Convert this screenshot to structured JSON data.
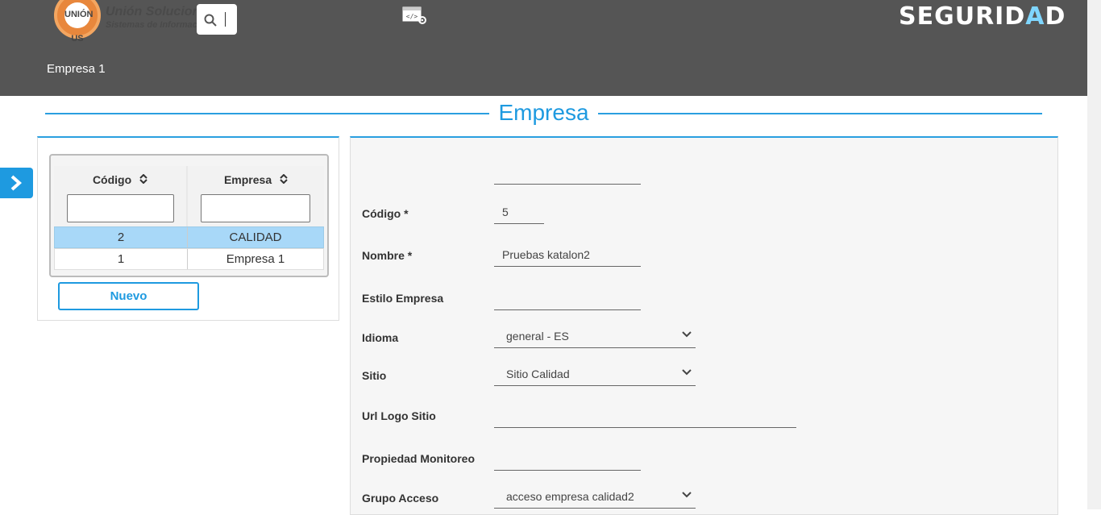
{
  "header": {
    "logo": {
      "badge": "UNIÓN US",
      "name": "Unión Soluciones",
      "subtitle": "Sistemas de Información"
    },
    "brand": {
      "part1": "SEGURID",
      "accent": "A",
      "part2": "D"
    },
    "breadcrumb": "Empresa 1"
  },
  "page": {
    "title": "Empresa"
  },
  "grid": {
    "columns": [
      {
        "label": "Código"
      },
      {
        "label": "Empresa"
      }
    ],
    "rows": [
      {
        "codigo": "2",
        "empresa": "CALIDAD",
        "selected": true
      },
      {
        "codigo": "1",
        "empresa": "Empresa 1",
        "selected": false
      }
    ],
    "new_button": "Nuevo"
  },
  "form": {
    "codigo": {
      "label": "Código *",
      "value": "5"
    },
    "nombre": {
      "label": "Nombre *",
      "value": "Pruebas katalon2"
    },
    "estilo": {
      "label": "Estilo Empresa",
      "value": ""
    },
    "idioma": {
      "label": "Idioma",
      "value": "general - ES"
    },
    "sitio": {
      "label": "Sitio",
      "value": "Sitio Calidad"
    },
    "url_logo": {
      "label": "Url Logo Sitio",
      "value": ""
    },
    "monitoreo": {
      "label": "Propiedad Monitoreo",
      "value": ""
    },
    "grupo": {
      "label": "Grupo Acceso",
      "value": "acceso empresa calidad2"
    }
  },
  "colors": {
    "accent": "#1e9ae0",
    "header_bg": "#555555",
    "selected_row": "#a8d8f8"
  }
}
